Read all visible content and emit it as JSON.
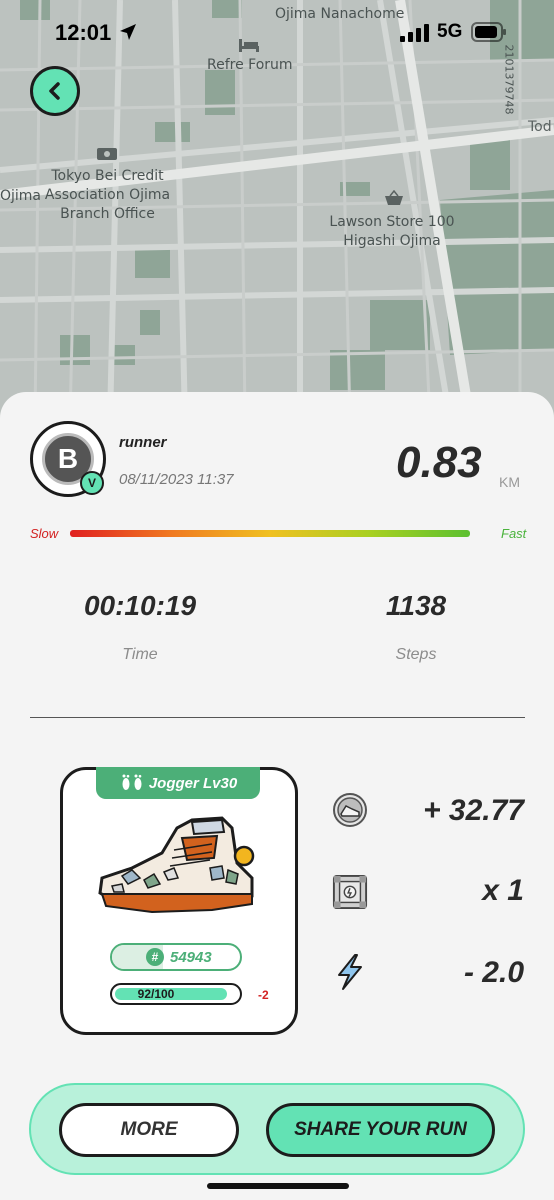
{
  "status_bar": {
    "time": "12:01",
    "network": "5G"
  },
  "map": {
    "labels": [
      "Ojima Nanachome",
      "Refre Forum",
      "Tokyo Bei Credit\nAssociation Ojima\nBranch Office",
      "Lawson Store 100\nHigashi Ojima",
      "Ojima",
      "2101379748",
      "Tod"
    ]
  },
  "run": {
    "runner_name": "runner",
    "avatar_symbol": "B",
    "verified_badge": "V",
    "date": "08/11/2023 11:37",
    "distance": "0.83",
    "distance_unit": "KM",
    "speed_slow_label": "Slow",
    "speed_fast_label": "Fast",
    "duration": "00:10:19",
    "duration_label": "Time",
    "steps": "1138",
    "steps_label": "Steps"
  },
  "sneaker": {
    "level_label": "Jogger Lv30",
    "id_symbol": "#",
    "id": "54943",
    "durability_text": "92/100",
    "durability_fraction": 0.92,
    "durability_change": "-2"
  },
  "rewards": {
    "earned": "+ 32.77",
    "boxes": "x 1",
    "energy": "- 2.0"
  },
  "actions": {
    "more_label": "MORE",
    "share_label": "SHARE YOUR RUN"
  },
  "colors": {
    "accent": "#63e2b4",
    "level_green": "#4caf78",
    "negative": "#d32222"
  }
}
